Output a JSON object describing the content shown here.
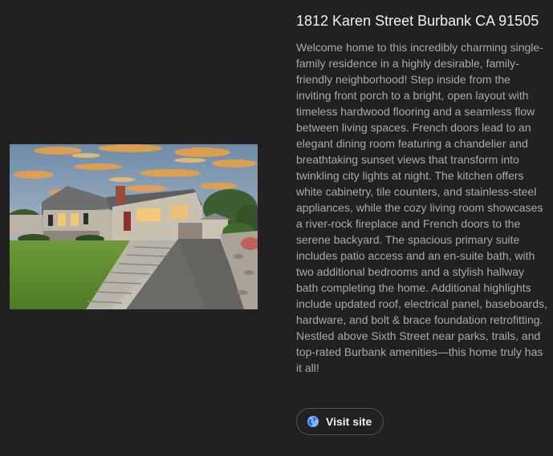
{
  "listing": {
    "title": "1812 Karen Street Burbank CA 91505",
    "description": "Welcome home to this incredibly charming single-family residence in a highly desirable, family-friendly neighborhood! Step inside from the inviting front porch to a bright, open layout with timeless hardwood flooring and a seamless flow between living spaces. French doors lead to an elegant dining room featuring a chandelier and breathtaking sunset views that transform into twinkling city lights at night. The kitchen offers white cabinetry, tile counters, and stainless-steel appliances, while the cozy living room showcases a river-rock fireplace and French doors to the serene backyard. The spacious primary suite includes patio access and an en-suite bath, with two additional bedrooms and a stylish hallway bath completing the home. Additional highlights include updated roof, electrical panel, baseboards, hardware, and bolt & brace foundation retrofitting. Nestled above Sixth Street near parks, trails, and top-rated Burbank amenities—this home truly has it all!",
    "visit_label": "Visit site",
    "visit_icon": "globe-icon",
    "accent_color": "#4285f4"
  }
}
